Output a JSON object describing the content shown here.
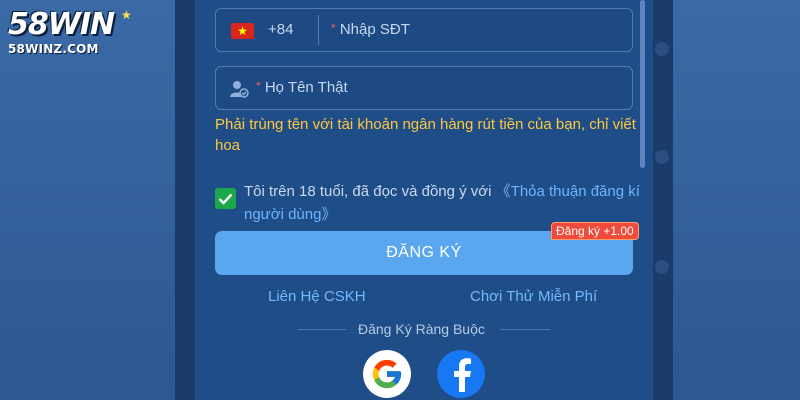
{
  "brand": {
    "logo_main_number": "58",
    "logo_main_word": "WIN",
    "logo_sub": "58WINZ.COM"
  },
  "form": {
    "phone": {
      "country_code": "+84",
      "required_mark": "*",
      "placeholder": "Nhập SĐT"
    },
    "name": {
      "required_mark": "*",
      "placeholder": "Họ Tên Thật"
    },
    "name_hint": "Phải trùng tên với tài khoản ngân hàng rút tiền của bạn, chỉ viết hoa",
    "agreement": {
      "checked": true,
      "text": "Tôi trên 18 tuổi, đã đọc và đồng ý với ",
      "link": "《Thỏa thuận đăng kí người dùng》"
    },
    "register_label": "ĐĂNG KÝ",
    "bonus_badge": "Đăng ký +1.00"
  },
  "links": {
    "support": "Liên Hệ CSKH",
    "free_trial": "Chơi Thử Miễn Phí"
  },
  "social": {
    "separator_text": "Đăng Ký Ràng Buộc",
    "providers": [
      "google-icon",
      "facebook-icon"
    ]
  },
  "colors": {
    "panel_bg": "#1f4d87",
    "accent_button": "#5aa7ef",
    "hint_yellow": "#ffc83d",
    "link_blue": "#74b8ff",
    "badge_red": "#f04a3a",
    "check_green": "#1aa84a"
  }
}
